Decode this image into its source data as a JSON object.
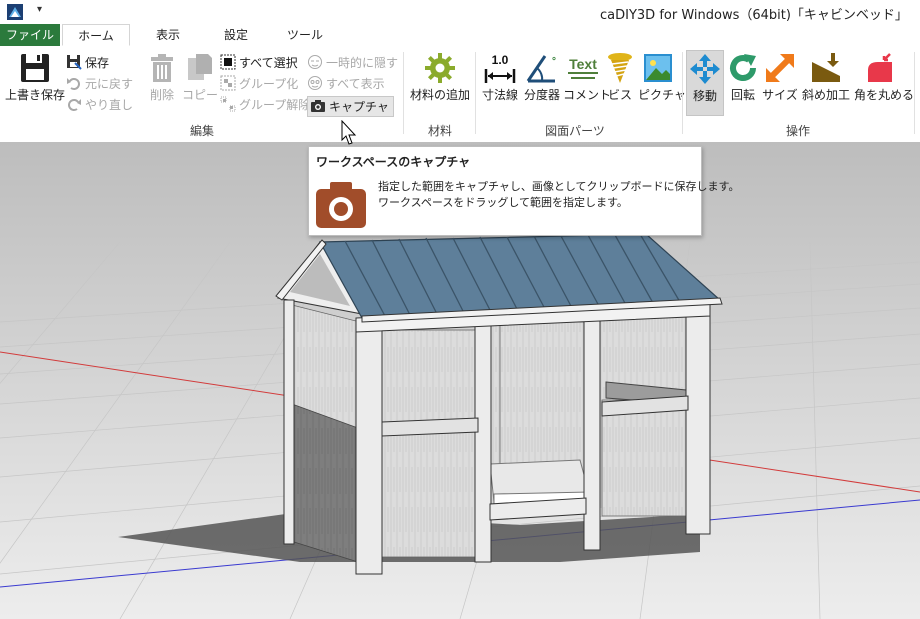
{
  "window": {
    "title": "caDIY3D for Windows（64bit)「キャビンベッド」",
    "qa_dropdown": "▾"
  },
  "tabs": {
    "file": "ファイル",
    "home": "ホーム",
    "view": "表示",
    "settings": "設定",
    "tools": "ツール"
  },
  "ribbon": {
    "edit_group": {
      "label": "編集",
      "overwrite_save": "上書き保存",
      "save": "保存",
      "undo": "元に戻す",
      "redo": "やり直し",
      "delete": "削除",
      "copy": "コピー",
      "select_all": "すべて選択",
      "group": "グループ化",
      "ungroup": "グループ解除",
      "hide_temp": "一時的に隠す",
      "show_all": "すべて表示",
      "capture": "キャプチャ"
    },
    "material_group": {
      "label": "材料",
      "add_material": "材料の追加"
    },
    "drawing_parts_group": {
      "label": "図面パーツ",
      "dimension": "寸法線",
      "dimension_icon_text": "1.0",
      "protractor": "分度器",
      "comment": "コメント",
      "comment_icon_text": "Text",
      "screw": "ビス",
      "picture": "ピクチャ"
    },
    "operation_group": {
      "label": "操作",
      "move": "移動",
      "rotate": "回転",
      "size": "サイズ",
      "bevel": "斜め加工",
      "round": "角を丸める"
    }
  },
  "tooltip": {
    "title": "ワークスペースのキャプチャ",
    "line1": "指定した範囲をキャプチャし、画像としてクリップボードに保存します。",
    "line2": "ワークスペースをドラッグして範囲を指定します。"
  },
  "colors": {
    "file_tab": "#2b7a3c",
    "roof": "#5e7f9a",
    "wood": "#dcdcdc",
    "grid_red": "#d23b3b",
    "grid_blue": "#3a3ad0",
    "tooltip_icon": "#a14d2a"
  }
}
